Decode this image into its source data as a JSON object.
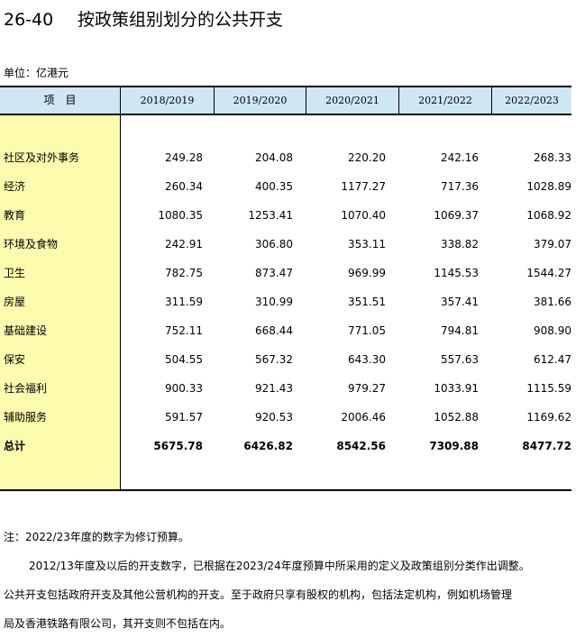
{
  "title": {
    "number": "26-40",
    "text": "按政策组别划分的公共开支"
  },
  "unit": "单位：亿港元",
  "header": {
    "item": "项　目",
    "years": [
      "2018/2019",
      "2019/2020",
      "2020/2021",
      "2021/2022",
      "2022/2023"
    ]
  },
  "rows": [
    {
      "label": "社区及对外事务",
      "values": [
        "249.28",
        "204.08",
        "220.20",
        "242.16",
        "268.33"
      ]
    },
    {
      "label": "经济",
      "values": [
        "260.34",
        "400.35",
        "1177.27",
        "717.36",
        "1028.89"
      ]
    },
    {
      "label": "教育",
      "values": [
        "1080.35",
        "1253.41",
        "1070.40",
        "1069.37",
        "1068.92"
      ]
    },
    {
      "label": "环境及食物",
      "values": [
        "242.91",
        "306.80",
        "353.11",
        "338.82",
        "379.07"
      ]
    },
    {
      "label": "卫生",
      "values": [
        "782.75",
        "873.47",
        "969.99",
        "1145.53",
        "1544.27"
      ]
    },
    {
      "label": "房屋",
      "values": [
        "311.59",
        "310.99",
        "351.51",
        "357.41",
        "381.66"
      ]
    },
    {
      "label": "基础建设",
      "values": [
        "752.11",
        "668.44",
        "771.05",
        "794.81",
        "908.90"
      ]
    },
    {
      "label": "保安",
      "values": [
        "504.55",
        "567.32",
        "643.30",
        "557.63",
        "612.47"
      ]
    },
    {
      "label": "社会福利",
      "values": [
        "900.33",
        "921.43",
        "979.27",
        "1033.91",
        "1115.59"
      ]
    },
    {
      "label": "辅助服务",
      "values": [
        "591.57",
        "920.53",
        "2006.46",
        "1052.88",
        "1169.62"
      ]
    }
  ],
  "total": {
    "label": "总计",
    "values": [
      "5675.78",
      "6426.82",
      "8542.56",
      "7309.88",
      "8477.72"
    ]
  },
  "notes": {
    "line1": "注：2022/23年度的数字为修订预算。",
    "line2": "2012/13年度及以后的开支数字，已根据在2023/24年度预算中所采用的定义及政策组别分类作出调整。",
    "line3": "公共开支包括政府开支及其他公营机构的开支。至于政府只享有股权的机构，包括法定机构，例如机场管理",
    "line4": "局及香港铁路有限公司，其开支则不包括在内。"
  }
}
